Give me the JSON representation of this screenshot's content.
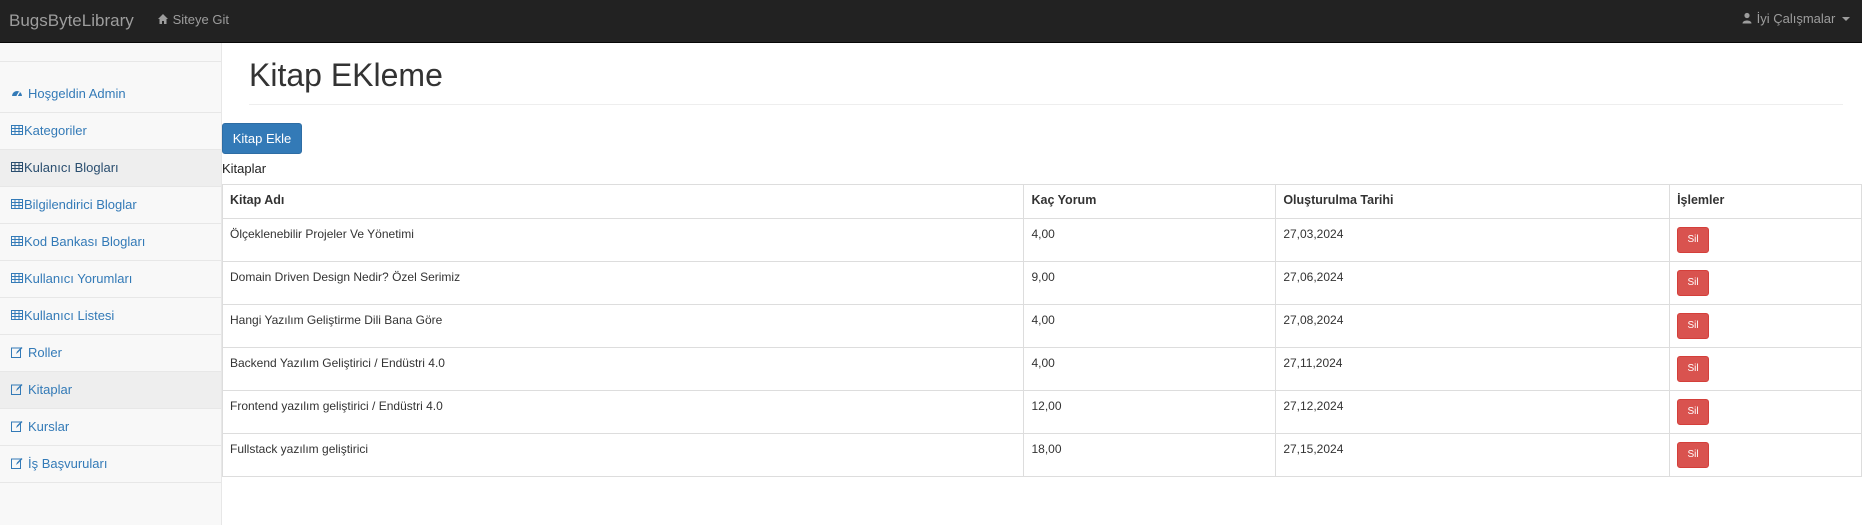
{
  "navbar": {
    "brand": "BugsByteLibrary",
    "site_link": "Siteye Git",
    "user_menu": "İyi Çalışmalar"
  },
  "sidebar": {
    "items": [
      {
        "label": "Hoşgeldin Admin",
        "icon": "dashboard-icon"
      },
      {
        "label": "Kategoriler",
        "icon": "table-icon"
      },
      {
        "label": "Kulanıcı Blogları",
        "icon": "table-icon"
      },
      {
        "label": "Bilgilendirici Bloglar",
        "icon": "table-icon"
      },
      {
        "label": "Kod Bankası Blogları",
        "icon": "table-icon"
      },
      {
        "label": "Kullanıcı Yorumları",
        "icon": "table-icon"
      },
      {
        "label": "Kullanıcı Listesi",
        "icon": "table-icon"
      },
      {
        "label": "Roller",
        "icon": "edit-icon"
      },
      {
        "label": "Kitaplar",
        "icon": "edit-icon"
      },
      {
        "label": "Kurslar",
        "icon": "edit-icon"
      },
      {
        "label": "İş Başvuruları",
        "icon": "edit-icon"
      }
    ]
  },
  "main": {
    "title": "Kitap EKleme",
    "add_button": "Kitap Ekle",
    "caption": "Kitaplar",
    "table": {
      "headers": [
        "Kitap Adı",
        "Kaç Yorum",
        "Oluşturulma Tarihi",
        "İşlemler"
      ],
      "delete_label": "Sil",
      "rows": [
        {
          "name": "Ölçeklenebilir Projeler Ve Yönetimi",
          "comments": "4,00",
          "date": "27,03,2024"
        },
        {
          "name": "Domain Driven Design Nedir? Özel Serimiz",
          "comments": "9,00",
          "date": "27,06,2024"
        },
        {
          "name": "Hangi Yazılım Geliştirme Dili Bana Göre",
          "comments": "4,00",
          "date": "27,08,2024"
        },
        {
          "name": "Backend Yazılım Geliştirici / Endüstri 4.0",
          "comments": "4,00",
          "date": "27,11,2024"
        },
        {
          "name": "Frontend yazılım geliştirici / Endüstri 4.0",
          "comments": "12,00",
          "date": "27,12,2024"
        },
        {
          "name": "Fullstack yazılım geliştirici",
          "comments": "18,00",
          "date": "27,15,2024"
        }
      ]
    }
  },
  "colors": {
    "navbar": "#222222",
    "link": "#337ab7",
    "primary_button": "#337ab7",
    "danger_button": "#d9534f"
  }
}
